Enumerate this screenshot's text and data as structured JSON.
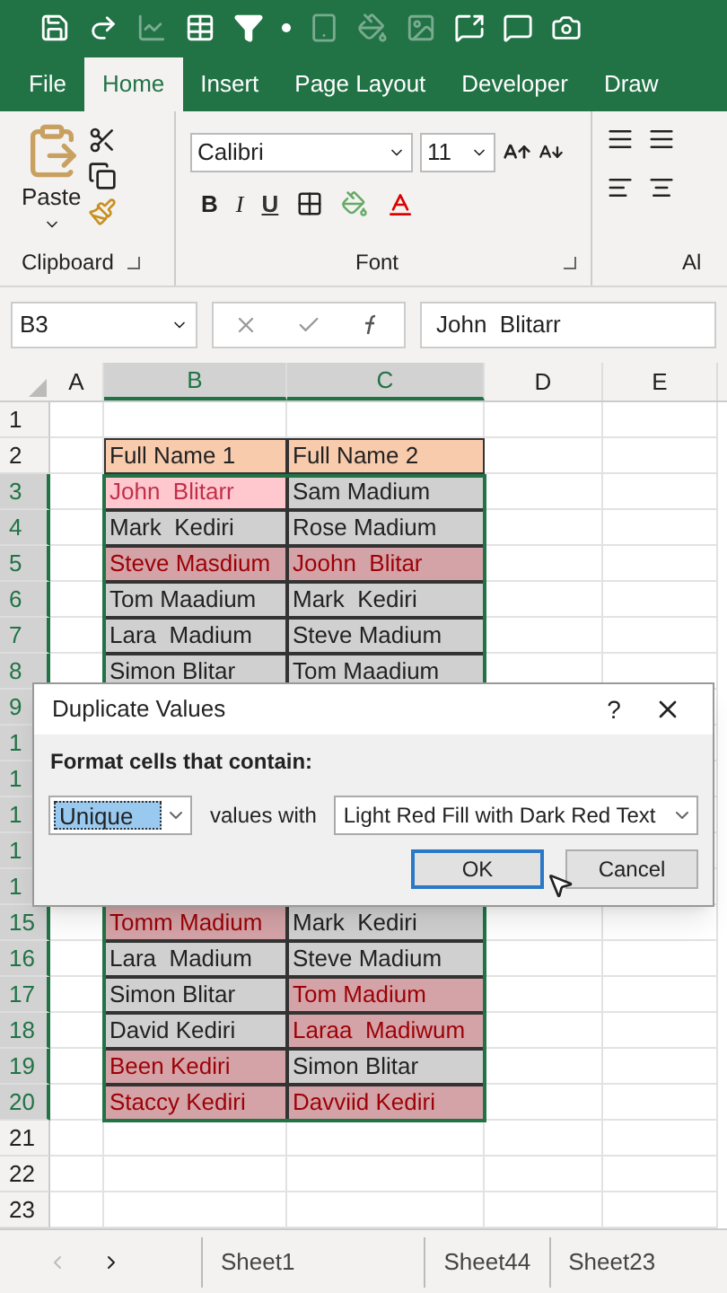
{
  "ribbon_tabs": [
    {
      "label": "File",
      "selected": false
    },
    {
      "label": "Home",
      "selected": true
    },
    {
      "label": "Insert",
      "selected": false
    },
    {
      "label": "Page Layout",
      "selected": false
    },
    {
      "label": "Developer",
      "selected": false
    },
    {
      "label": "Draw",
      "selected": false
    }
  ],
  "clipboard": {
    "paste_label": "Paste",
    "group_label": "Clipboard"
  },
  "font": {
    "name": "Calibri",
    "size": "11",
    "bold": "B",
    "italic": "I",
    "underline": "U",
    "group_label": "Font"
  },
  "alignment": {
    "group_label": "Al"
  },
  "formula_bar": {
    "name_box": "B3",
    "value": "John  Blitarr"
  },
  "columns": [
    {
      "label": "A",
      "selected": false
    },
    {
      "label": "B",
      "selected": true
    },
    {
      "label": "C",
      "selected": true
    },
    {
      "label": "D",
      "selected": false
    },
    {
      "label": "E",
      "selected": false
    }
  ],
  "rows": [
    {
      "number": "1",
      "selected": false,
      "cells": []
    },
    {
      "number": "2",
      "selected": false,
      "kind": "header",
      "cells": [
        {
          "text": "Full Name 1"
        },
        {
          "text": "Full Name 2"
        }
      ]
    },
    {
      "number": "3",
      "selected": true,
      "cells": [
        {
          "text": "John  Blitarr",
          "highlighted": true,
          "active": true
        },
        {
          "text": "Sam Madium",
          "highlighted": false,
          "active": false
        }
      ]
    },
    {
      "number": "4",
      "selected": true,
      "cells": [
        {
          "text": "Mark  Kediri",
          "highlighted": false,
          "active": false
        },
        {
          "text": "Rose Madium",
          "highlighted": false,
          "active": false
        }
      ]
    },
    {
      "number": "5",
      "selected": true,
      "cells": [
        {
          "text": "Steve Masdium",
          "highlighted": true,
          "active": false
        },
        {
          "text": "Joohn  Blitar",
          "highlighted": true,
          "active": false
        }
      ]
    },
    {
      "number": "6",
      "selected": true,
      "cells": [
        {
          "text": "Tom Maadium",
          "highlighted": false,
          "active": false
        },
        {
          "text": "Mark  Kediri",
          "highlighted": false,
          "active": false
        }
      ]
    },
    {
      "number": "7",
      "selected": true,
      "cells": [
        {
          "text": "Lara  Madium",
          "highlighted": false,
          "active": false
        },
        {
          "text": "Steve Madium",
          "highlighted": false,
          "active": false
        }
      ]
    },
    {
      "number": "8",
      "selected": true,
      "cells": [
        {
          "text": "Simon Blitar",
          "highlighted": false,
          "active": false
        },
        {
          "text": "Tom Maadium",
          "highlighted": false,
          "active": false
        }
      ]
    },
    {
      "number": "9",
      "selected": true,
      "cells": []
    },
    {
      "number": "1",
      "selected": true,
      "cells": []
    },
    {
      "number": "1",
      "selected": true,
      "cells": []
    },
    {
      "number": "1",
      "selected": true,
      "cells": []
    },
    {
      "number": "1",
      "selected": true,
      "cells": []
    },
    {
      "number": "1",
      "selected": true,
      "cells": []
    },
    {
      "number": "15",
      "selected": true,
      "cells": [
        {
          "text": "Tomm Madium",
          "highlighted": true,
          "active": false
        },
        {
          "text": "Mark  Kediri",
          "highlighted": false,
          "active": false
        }
      ]
    },
    {
      "number": "16",
      "selected": true,
      "cells": [
        {
          "text": "Lara  Madium",
          "highlighted": false,
          "active": false
        },
        {
          "text": "Steve Madium",
          "highlighted": false,
          "active": false
        }
      ]
    },
    {
      "number": "17",
      "selected": true,
      "cells": [
        {
          "text": "Simon Blitar",
          "highlighted": false,
          "active": false
        },
        {
          "text": "Tom Madium",
          "highlighted": true,
          "active": false
        }
      ]
    },
    {
      "number": "18",
      "selected": true,
      "cells": [
        {
          "text": "David Kediri",
          "highlighted": false,
          "active": false
        },
        {
          "text": "Laraa  Madiwum",
          "highlighted": true,
          "active": false
        }
      ]
    },
    {
      "number": "19",
      "selected": true,
      "cells": [
        {
          "text": "Been Kediri",
          "highlighted": true,
          "active": false
        },
        {
          "text": "Simon Blitar",
          "highlighted": false,
          "active": false
        }
      ]
    },
    {
      "number": "20",
      "selected": true,
      "cells": [
        {
          "text": "Staccy Kediri",
          "highlighted": true,
          "active": false
        },
        {
          "text": "Davviid Kediri",
          "highlighted": true,
          "active": false
        }
      ]
    },
    {
      "number": "21",
      "selected": false,
      "cells": []
    },
    {
      "number": "22",
      "selected": false,
      "cells": []
    },
    {
      "number": "23",
      "selected": false,
      "cells": []
    }
  ],
  "dialog": {
    "title": "Duplicate Values",
    "help": "?",
    "prompt": "Format cells that contain:",
    "rule": "Unique",
    "connector": "values with",
    "format": "Light Red Fill with Dark Red Text",
    "ok": "OK",
    "cancel": "Cancel"
  },
  "sheet_tabs": [
    "Sheet1",
    "Sheet44",
    "Sheet23"
  ]
}
